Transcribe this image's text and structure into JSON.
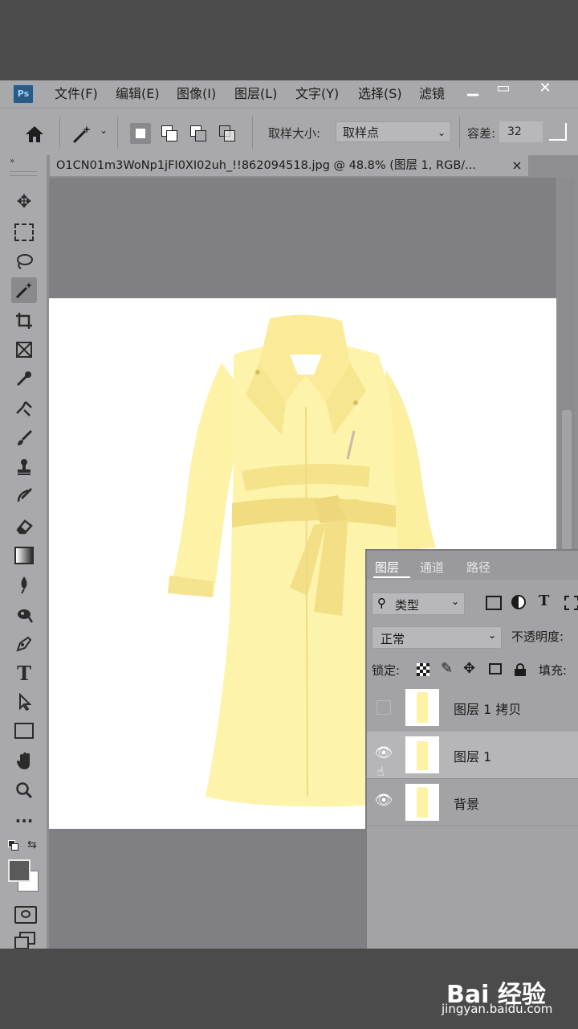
{
  "app": {
    "logo": "Ps",
    "menu": [
      "文件(F)",
      "编辑(E)",
      "图像(I)",
      "图层(L)",
      "文字(Y)",
      "选择(S)",
      "滤镜"
    ],
    "window_controls": [
      "minimize-icon",
      "restore-icon",
      "close-icon"
    ]
  },
  "options_bar": {
    "sample_size_label": "取样大小:",
    "sample_size_value": "取样点",
    "tolerance_label": "容差:",
    "tolerance_value": "32"
  },
  "document": {
    "tab_title": "O1CN01m3WoNp1jFI0XI02uh_!!862094518.jpg  @  48.8% (图层 1, RGB/...",
    "tab_close": "×"
  },
  "toolbar": {
    "tools": [
      "move-icon",
      "marquee-icon",
      "lasso-icon",
      "magic-wand-icon",
      "crop-icon",
      "frame-icon",
      "eyedropper-icon",
      "healing-brush-icon",
      "brush-icon",
      "clone-stamp-icon",
      "history-brush-icon",
      "eraser-icon",
      "gradient-icon",
      "blur-icon",
      "dodge-icon",
      "pen-icon",
      "type-icon",
      "path-selection-icon",
      "rectangle-icon",
      "hand-icon",
      "zoom-icon",
      "more-icon"
    ],
    "more_label": "···",
    "type_tool_label": "T"
  },
  "layers_panel": {
    "tabs": [
      "图层",
      "通道",
      "路径"
    ],
    "filter_kind": "类型",
    "blend_mode": "正常",
    "opacity_label": "不透明度:",
    "lock_label": "锁定:",
    "fill_label": "填充:",
    "layers": [
      {
        "name": "图层 1 拷贝",
        "visible": false,
        "selected": false
      },
      {
        "name": "图层 1",
        "visible": true,
        "selected": true
      },
      {
        "name": "背景",
        "visible": true,
        "selected": false
      }
    ]
  },
  "watermark": {
    "logo": "Bai 经验",
    "url": "jingyan.baidu.com"
  },
  "colors": {
    "coat": "#fdf2a6",
    "coat_shadow": "#f3df86",
    "panel_bg": "#a3a2a5",
    "ui_bg": "#a9a8ab"
  }
}
